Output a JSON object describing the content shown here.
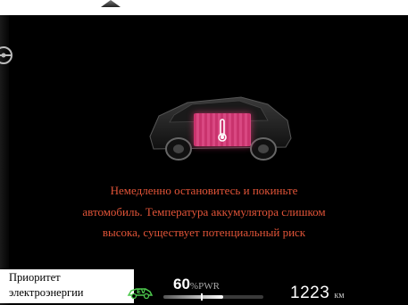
{
  "warning": {
    "line1": "Немедленно остановитесь и покиньте",
    "line2": "автомобиль. Температура аккумулятора слишком",
    "line3": "высока, существует потенциальный риск",
    "color": "#e25438"
  },
  "mode": {
    "line1": "Приоритет",
    "line2": "электроэнергии",
    "icon": "ev-car-icon"
  },
  "power": {
    "value": "60",
    "unit": "%PWR",
    "level": 0.6
  },
  "range": {
    "value": "1223",
    "unit": "км"
  },
  "icons": {
    "vehicle": "car-top-view-icon",
    "battery": "battery-overheat-icon",
    "temperature": "thermometer-icon",
    "steering": "steering-wheel-icon"
  }
}
